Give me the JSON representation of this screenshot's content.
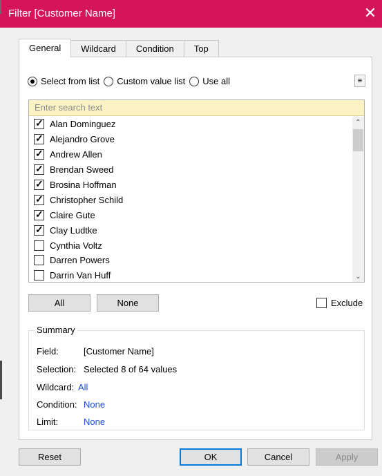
{
  "window": {
    "title": "Filter [Customer Name]",
    "close_glyph": "✕",
    "titlebar_color": "#d4155a"
  },
  "tabs": [
    "General",
    "Wildcard",
    "Condition",
    "Top"
  ],
  "selection_mode": {
    "options": [
      "Select from list",
      "Custom value list",
      "Use all"
    ],
    "selected": "Select from list"
  },
  "search": {
    "placeholder": "Enter search text"
  },
  "list": {
    "items": [
      {
        "label": "Alan Dominguez",
        "checked": true
      },
      {
        "label": "Alejandro Grove",
        "checked": true
      },
      {
        "label": "Andrew Allen",
        "checked": true
      },
      {
        "label": "Brendan Sweed",
        "checked": true
      },
      {
        "label": "Brosina Hoffman",
        "checked": true
      },
      {
        "label": "Christopher Schild",
        "checked": true
      },
      {
        "label": "Claire Gute",
        "checked": true
      },
      {
        "label": "Clay Ludtke",
        "checked": true
      },
      {
        "label": "Cynthia Voltz",
        "checked": false
      },
      {
        "label": "Darren Powers",
        "checked": false
      },
      {
        "label": "Darrin Van Huff",
        "checked": false
      }
    ]
  },
  "buttons": {
    "all": "All",
    "none": "None",
    "reset": "Reset",
    "ok": "OK",
    "cancel": "Cancel",
    "apply": "Apply"
  },
  "exclude": {
    "label": "Exclude",
    "checked": false
  },
  "summary": {
    "legend": "Summary",
    "field_label": "Field:",
    "field_value": "[Customer Name]",
    "selection_label": "Selection:",
    "selection_value": "Selected 8 of 64 values",
    "wildcard_label": "Wildcard:",
    "wildcard_value": "All",
    "condition_label": "Condition:",
    "condition_value": "None",
    "limit_label": "Limit:",
    "limit_value": "None"
  }
}
